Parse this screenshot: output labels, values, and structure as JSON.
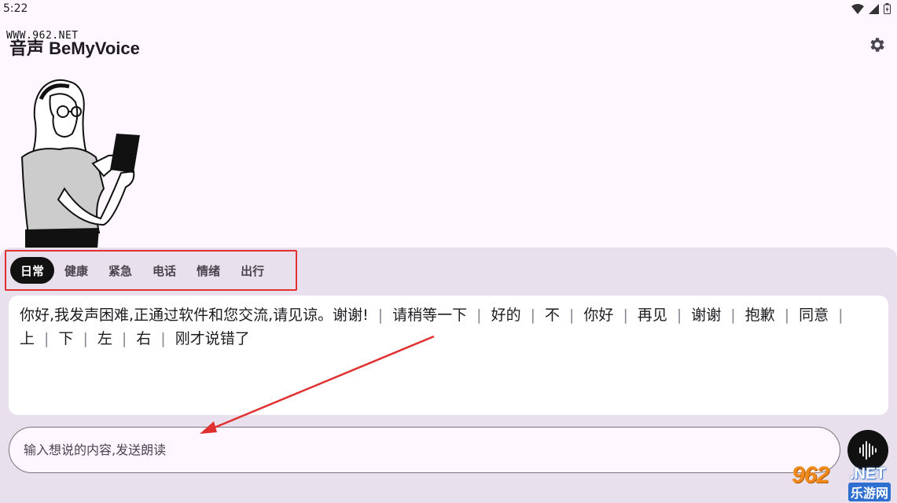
{
  "status_bar": {
    "time": "5:22"
  },
  "app_bar": {
    "title": "音声 BeMyVoice",
    "watermark": "WWW.962.NET"
  },
  "tabs": [
    {
      "label": "日常",
      "active": true
    },
    {
      "label": "健康",
      "active": false
    },
    {
      "label": "紧急",
      "active": false
    },
    {
      "label": "电话",
      "active": false
    },
    {
      "label": "情绪",
      "active": false
    },
    {
      "label": "出行",
      "active": false
    }
  ],
  "phrases": [
    "你好,我发声困难,正通过软件和您交流,请见谅。谢谢!",
    "请稍等一下",
    "好的",
    "不",
    "你好",
    "再见",
    "谢谢",
    "抱歉",
    "同意",
    "上",
    "下",
    "左",
    "右",
    "刚才说错了"
  ],
  "phrase_separator": "|",
  "input": {
    "placeholder": "输入想说的内容,发送朗读",
    "value": ""
  },
  "site_logo": {
    "number": "962",
    "suffix": ".NET",
    "chinese": "乐游网"
  },
  "colors": {
    "background": "#fef7ff",
    "panel": "#e8e0ec",
    "active_tab": "#111111",
    "annotation": "#e03030"
  }
}
